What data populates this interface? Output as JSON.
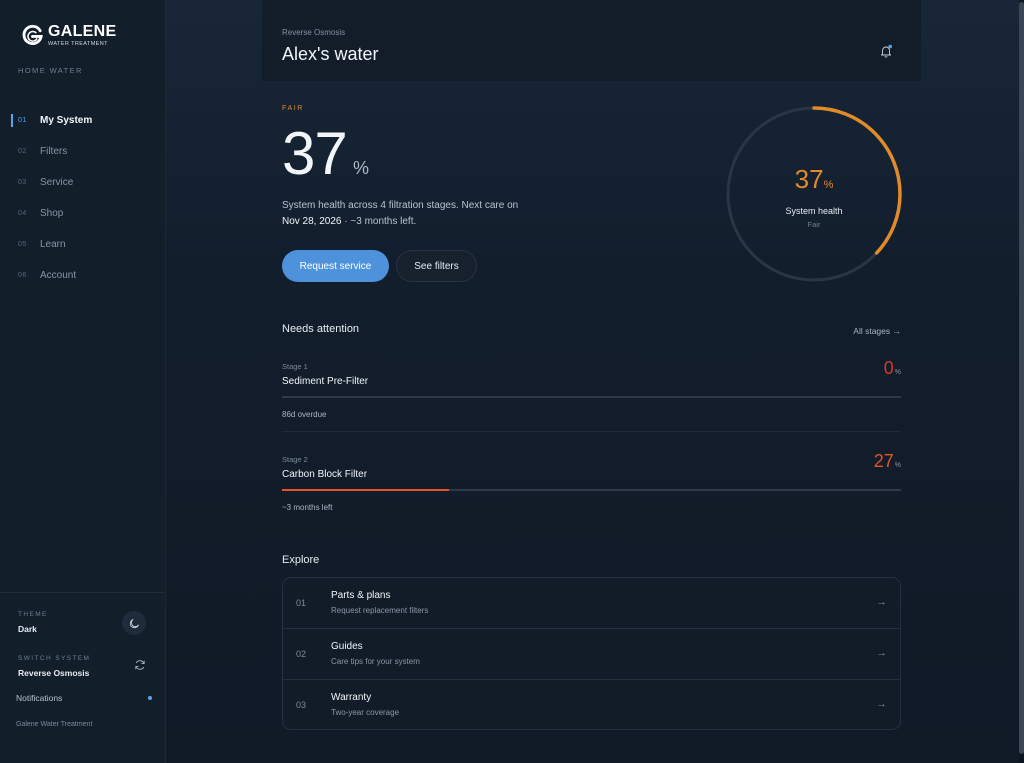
{
  "brand": {
    "name": "GALENE",
    "sub": "WATER TREATMENT"
  },
  "sidebar": {
    "section_label": "HOME WATER",
    "items": [
      {
        "num": "01",
        "label": "My System",
        "active": true
      },
      {
        "num": "02",
        "label": "Filters"
      },
      {
        "num": "03",
        "label": "Service"
      },
      {
        "num": "04",
        "label": "Shop"
      },
      {
        "num": "05",
        "label": "Learn"
      },
      {
        "num": "06",
        "label": "Account"
      }
    ],
    "theme_label": "THEME",
    "theme_value": "Dark",
    "switch_label": "SWITCH SYSTEM",
    "switch_value": "Reverse Osmosis",
    "notifications": "Notifications",
    "footer": "Galene Water Treatment"
  },
  "header": {
    "crumb": "Reverse Osmosis",
    "title": "Alex's water"
  },
  "health": {
    "status": "FAIR",
    "value": "37",
    "unit": "%",
    "desc_prefix": "System health across 4 filtration stages. Next care on",
    "next_date": "Nov 28, 2026",
    "desc_suffix": " · ~3 months left.",
    "fraction": 0.37,
    "gauge_label": "System health",
    "gauge_sub": "Fair"
  },
  "actions": {
    "primary": "Request service",
    "secondary": "See filters"
  },
  "attention": {
    "title": "Needs attention",
    "all_link": "All stages →",
    "stages": [
      {
        "num": "Stage 1",
        "name": "Sediment Pre-Filter",
        "pct": "0",
        "unit": "%",
        "fraction": 0,
        "note": "86d overdue",
        "color": "#d23a2e"
      },
      {
        "num": "Stage 2",
        "name": "Carbon Block Filter",
        "pct": "27",
        "unit": "%",
        "fraction": 0.27,
        "note": "~3 months left",
        "color": "#e0552a"
      }
    ]
  },
  "explore": {
    "title": "Explore",
    "items": [
      {
        "num": "01",
        "title": "Parts & plans",
        "sub": "Request replacement filters"
      },
      {
        "num": "02",
        "title": "Guides",
        "sub": "Care tips for your system"
      },
      {
        "num": "03",
        "title": "Warranty",
        "sub": "Two-year coverage"
      }
    ],
    "arrow": "→"
  },
  "colors": {
    "accent": "#4f92dc",
    "warning": "#e08a2a",
    "danger": "#d23a2e"
  }
}
